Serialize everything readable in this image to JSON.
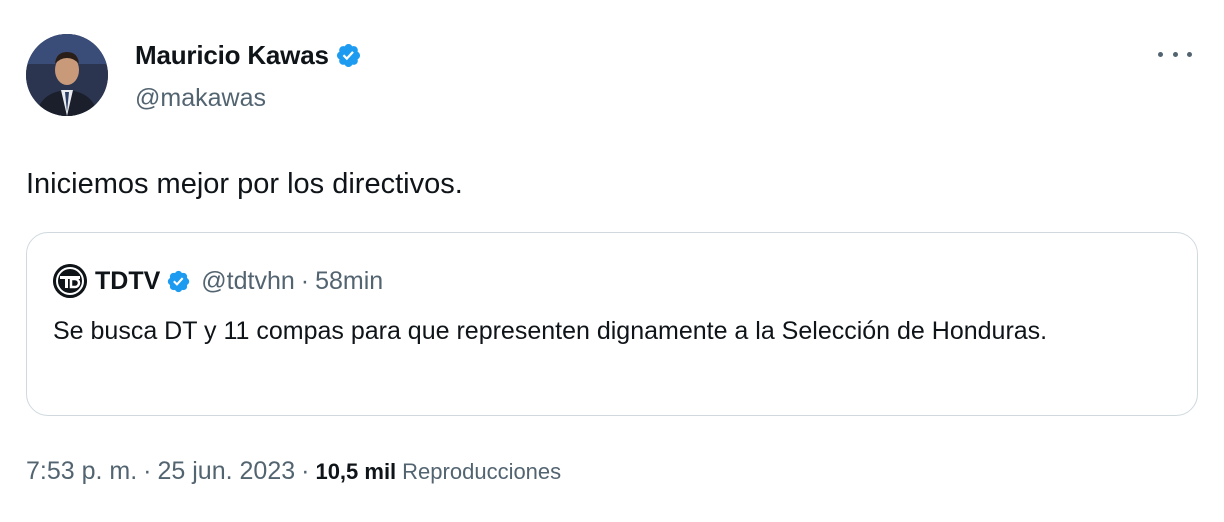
{
  "author": {
    "name": "Mauricio Kawas",
    "handle": "@makawas",
    "verified": true
  },
  "tweet": {
    "text": "Iniciemos mejor por los directivos."
  },
  "quoted": {
    "name": "TDTV",
    "handle": "@tdtvhn",
    "separator": "·",
    "time": "58min",
    "text": "Se busca DT y 11 compas para que representen dignamente a la Selección de Honduras."
  },
  "meta": {
    "time": "7:53 p. m.",
    "sep1": "·",
    "date": "25 jun. 2023",
    "sep2": "·",
    "views_count": "10,5 mil",
    "views_label": "Reproducciones"
  },
  "colors": {
    "verified": "#1d9bf0",
    "secondary_text": "#536471",
    "border": "#cfd9de"
  },
  "icons": {
    "verified": "verified-badge-icon",
    "more": "more-options-icon"
  }
}
